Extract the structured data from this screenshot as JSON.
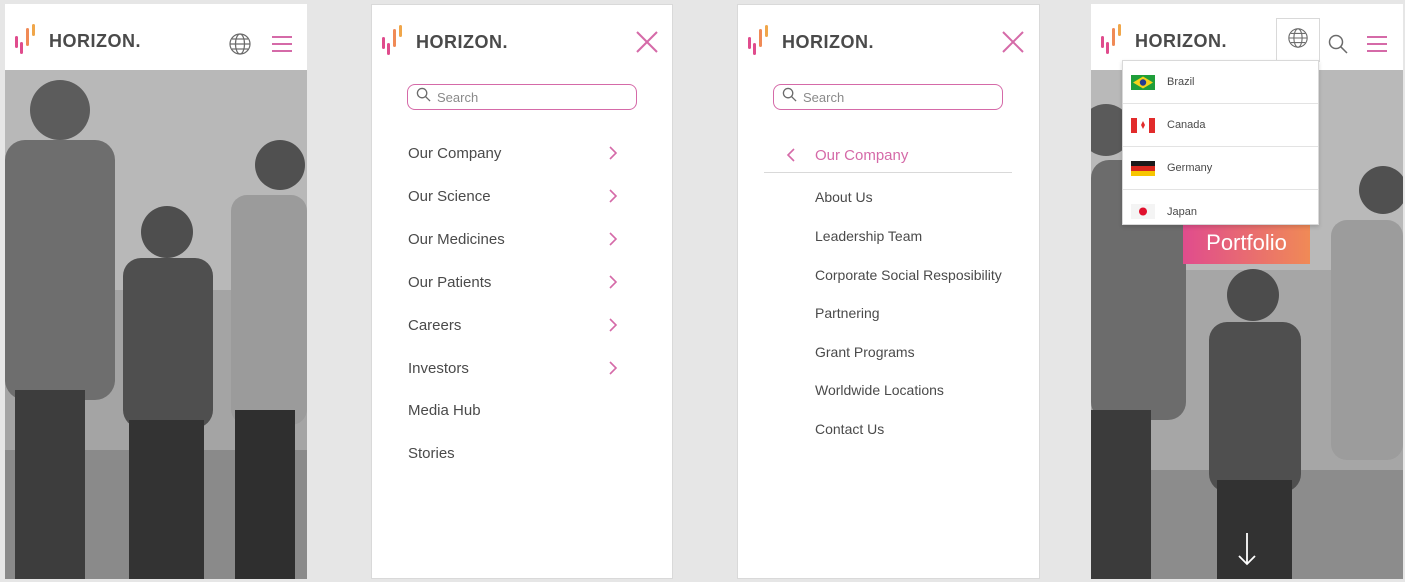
{
  "brand": {
    "name": "HORIZON."
  },
  "colors": {
    "accent": "#d56aa8",
    "pink": "#e04c8d",
    "orange": "#f0a64a",
    "text": "#4a4a4a"
  },
  "icons": [
    "globe-icon",
    "hamburger-icon",
    "close-icon",
    "search-icon",
    "chevron-right-icon",
    "chevron-left-icon",
    "arrow-down-icon"
  ],
  "search": {
    "placeholder": "Search"
  },
  "menu": {
    "items": [
      {
        "label": "Our Company"
      },
      {
        "label": "Our Science"
      },
      {
        "label": "Our Medicines"
      },
      {
        "label": "Our Patients"
      },
      {
        "label": "Careers"
      },
      {
        "label": "Investors"
      },
      {
        "label": "Media Hub"
      },
      {
        "label": "Stories"
      }
    ]
  },
  "submenu": {
    "title": "Our Company",
    "items": [
      {
        "label": "About Us"
      },
      {
        "label": "Leadership Team"
      },
      {
        "label": "Corporate Social Resposibility"
      },
      {
        "label": "Partnering"
      },
      {
        "label": "Grant Programs"
      },
      {
        "label": "Worldwide Locations"
      },
      {
        "label": "Contact Us"
      }
    ]
  },
  "countries": [
    {
      "label": "Brazil"
    },
    {
      "label": "Canada"
    },
    {
      "label": "Germany"
    },
    {
      "label": "Japan"
    }
  ],
  "hero": {
    "cta_label": "Portfolio"
  }
}
